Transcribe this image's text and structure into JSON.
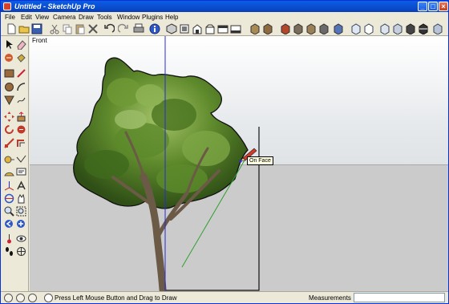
{
  "window": {
    "title": "Untitled - SketchUp Pro"
  },
  "menu": [
    "File",
    "Edit",
    "View",
    "Camera",
    "Draw",
    "Tools",
    "Window",
    "Plugins",
    "Help"
  ],
  "viewport": {
    "view_label": "Front",
    "inference_tooltip": "On Face"
  },
  "status": {
    "hint": "Press Left Mouse Button and Drag to Draw",
    "measurements_label": "Measurements",
    "measurements_value": ""
  },
  "colors": {
    "title_bar": "#0b4fd2",
    "axis_blue": "#2a2ad6",
    "inference_green": "#2f9f2f",
    "foliage": "#4f7d25",
    "trunk": "#6b5a45"
  }
}
